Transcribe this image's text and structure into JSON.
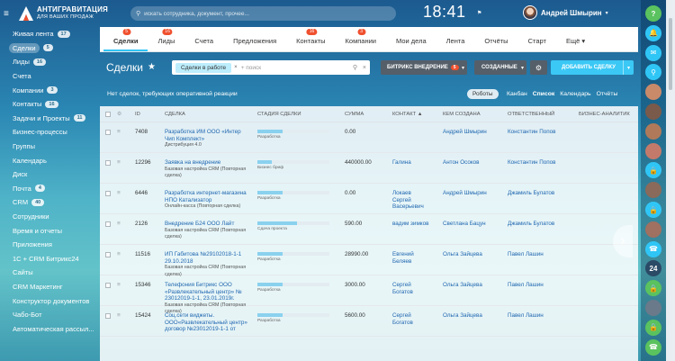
{
  "header": {
    "logo_title": "АНТИГРАВИТАЦИЯ",
    "logo_subtitle": "ДЛЯ ВАШИХ ПРОДАЖ",
    "search_placeholder": "искать сотрудника, документ, прочее...",
    "clock": "18:41",
    "clock_flag": "⚑",
    "user_name": "Андрей Шмырин"
  },
  "sidebar": [
    {
      "label": "Живая лента",
      "count": "17"
    },
    {
      "label": "Сделки",
      "count": "5",
      "active": true
    },
    {
      "label": "Лиды",
      "count": "16"
    },
    {
      "label": "Счета",
      "count": ""
    },
    {
      "label": "Компании",
      "count": "3"
    },
    {
      "label": "Контакты",
      "count": "16"
    },
    {
      "label": "Задачи и Проекты",
      "count": "11"
    },
    {
      "label": "Бизнес-процессы",
      "count": ""
    },
    {
      "label": "Группы",
      "count": ""
    },
    {
      "label": "Календарь",
      "count": ""
    },
    {
      "label": "Диск",
      "count": ""
    },
    {
      "label": "Почта",
      "count": "4"
    },
    {
      "label": "CRM",
      "count": "40"
    },
    {
      "label": "Сотрудники",
      "count": ""
    },
    {
      "label": "Время и отчеты",
      "count": ""
    },
    {
      "label": "Приложения",
      "count": ""
    },
    {
      "label": "1С + CRM Битрикс24",
      "count": ""
    },
    {
      "label": "Сайты",
      "count": ""
    },
    {
      "label": "CRM Маркетинг",
      "count": ""
    },
    {
      "label": "Конструктор документов",
      "count": ""
    },
    {
      "label": "Чабо-Бот",
      "count": ""
    },
    {
      "label": "Автоматическая рассыл...",
      "count": ""
    }
  ],
  "tabs": [
    {
      "label": "Сделки",
      "badge": "5",
      "active": true
    },
    {
      "label": "Лиды",
      "badge": "16"
    },
    {
      "label": "Счета",
      "badge": ""
    },
    {
      "label": "Предложения",
      "badge": ""
    },
    {
      "label": "Контакты",
      "badge": "16"
    },
    {
      "label": "Компании",
      "badge": "3"
    },
    {
      "label": "Мои дела",
      "badge": ""
    },
    {
      "label": "Лента",
      "badge": ""
    },
    {
      "label": "Отчёты",
      "badge": ""
    },
    {
      "label": "Старт",
      "badge": ""
    },
    {
      "label": "Ещё ▾",
      "badge": ""
    }
  ],
  "toolbar": {
    "page_title": "Сделки",
    "filter_chip": "Сделки в работе",
    "filter_search_placeholder": "+ поиск",
    "pipeline_label": "БИТРИКС ВНЕДРЕНИЕ",
    "pipeline_badge": "5",
    "created_label": "СОЗДАННЫЕ",
    "add_label": "ДОБАВИТЬ СДЕЛКУ"
  },
  "info": {
    "message": "Нет сделок, требующих оперативной реакции",
    "robots": "Роботы",
    "views": [
      "Канбан",
      "Список",
      "Календарь",
      "Отчёты"
    ],
    "active_view": 1
  },
  "columns": {
    "id": "ID",
    "deal": "СДЕЛКА",
    "stage": "СТАДИЯ СДЕЛКИ",
    "sum": "СУММА",
    "contact": "КОНТАКТ ▲",
    "created_by": "КЕМ СОЗДАНА",
    "responsible": "ОТВЕТСТВЕННЫЙ",
    "analyst": "БИЗНЕС-АНАЛИТИК"
  },
  "rows": [
    {
      "id": "7408",
      "deal": [
        "Разработка ИМ ООО «Интер",
        "Чип Комплект»"
      ],
      "sub": [
        "Дистрибуция 4.0"
      ],
      "stage": "Разработка",
      "progress": 0.35,
      "sum": "0.00",
      "contact": [],
      "created_by": "Андрей Шмырин",
      "responsible": "Константин Попов"
    },
    {
      "id": "12296",
      "deal": [
        "Заявка на внедрение"
      ],
      "sub": [
        "Базовая настройка CRM (Повторная",
        "сделка)"
      ],
      "stage": "Бизнес бриф",
      "progress": 0.2,
      "sum": "440000.00",
      "contact": [
        "Галина"
      ],
      "created_by": "Антон Осоков",
      "responsible": "Константин Попов"
    },
    {
      "id": "6446",
      "deal": [
        "Разработка интернет-магазина",
        "НПО Катализатор"
      ],
      "sub": [
        "Онлайн-касса (Повторная сделка)"
      ],
      "stage": "Разработка",
      "progress": 0.35,
      "sum": "0.00",
      "contact": [
        "Локаев",
        "Сергей",
        "Васерьевич"
      ],
      "created_by": "Андрей Шмырин",
      "responsible": "Джамиль Булатов"
    },
    {
      "id": "2126",
      "deal": [
        "Внедрение Б24 ООО Лайт"
      ],
      "sub": [
        "Базовая настройка CRM (Повторная",
        "сделка)"
      ],
      "stage": "Сдача проекта",
      "progress": 0.55,
      "sum": "590.00",
      "contact": [
        "вадим зимков"
      ],
      "created_by": "Светлана Бацун",
      "responsible": "Джамиль Булатов"
    },
    {
      "id": "11516",
      "deal": [
        "ИП Габитова №29102018-1-1",
        "29.10.2018"
      ],
      "sub": [
        "Базовая настройка CRM (Повторная",
        "сделка)"
      ],
      "stage": "Разработка",
      "progress": 0.35,
      "sum": "28990.00",
      "contact": [
        "Евгений",
        "Беляев"
      ],
      "created_by": "Ольга Зайцева",
      "responsible": "Павел Лашин"
    },
    {
      "id": "15346",
      "deal": [
        "Телефония Битрикс ООО",
        "«Развлекательный центр» №",
        "23012019-1-1, 23.01.2019г."
      ],
      "sub": [
        "Базовая настройка CRM (Повторная",
        "сделка)"
      ],
      "stage": "Разработка",
      "progress": 0.35,
      "sum": "3000.00",
      "contact": [
        "Сергей",
        "Богатов"
      ],
      "created_by": "Ольга Зайцева",
      "responsible": "Павел Лашин"
    },
    {
      "id": "15424",
      "deal": [
        "Соц.сети виджеты.",
        "ООО«Развлекательный центр»",
        "договор №23012019-1-1 от"
      ],
      "sub": [],
      "stage": "Разработка",
      "progress": 0.35,
      "sum": "5600.00",
      "contact": [
        "Сергей",
        "Богатов"
      ],
      "created_by": "Ольга Зайцева",
      "responsible": "Павел Лашин"
    }
  ],
  "rightbar": [
    {
      "icon": "help-icon",
      "glyph": "?",
      "color": "#5ac25e",
      "badge": ""
    },
    {
      "icon": "bell-icon",
      "glyph": "🔔",
      "color": "#2fc6f6",
      "badge": ""
    },
    {
      "icon": "chat-icon",
      "glyph": "✉",
      "color": "#2fc6f6",
      "badge": ""
    },
    {
      "icon": "search-icon",
      "glyph": "⚲",
      "color": "#2fc6f6",
      "badge": ""
    },
    {
      "icon": "avatar-icon",
      "glyph": "",
      "color": "#c98a6a",
      "badge": ""
    },
    {
      "icon": "avatar-icon",
      "glyph": "",
      "color": "#7a5a4a",
      "badge": ""
    },
    {
      "icon": "avatar-icon",
      "glyph": "",
      "color": "#b07a5a",
      "badge": ""
    },
    {
      "icon": "avatar-icon",
      "glyph": "",
      "color": "#c47a6a",
      "badge": ""
    },
    {
      "icon": "lock-icon",
      "glyph": "🔒",
      "color": "#2fc6f6",
      "badge": ""
    },
    {
      "icon": "avatar-icon",
      "glyph": "",
      "color": "#8a6a5a",
      "badge": ""
    },
    {
      "icon": "lock-icon",
      "glyph": "🔒",
      "color": "#2fc6f6",
      "badge": ""
    },
    {
      "icon": "avatar-icon",
      "glyph": "",
      "color": "#a07060",
      "badge": ""
    },
    {
      "icon": "phone-icon",
      "glyph": "☎",
      "color": "#2fc6f6",
      "badge": ""
    },
    {
      "icon": "calendar-icon",
      "glyph": "24",
      "color": "#2a4a66",
      "badge": ""
    },
    {
      "icon": "lock-icon",
      "glyph": "🔒",
      "color": "#5ac25e",
      "badge": ""
    },
    {
      "icon": "avatar-icon",
      "glyph": "",
      "color": "#6a7a8a",
      "badge": ""
    },
    {
      "icon": "lock-icon",
      "glyph": "🔒",
      "color": "#5ac25e",
      "badge": ""
    },
    {
      "icon": "phone-icon",
      "glyph": "☎",
      "color": "#5ac25e",
      "badge": ""
    }
  ]
}
